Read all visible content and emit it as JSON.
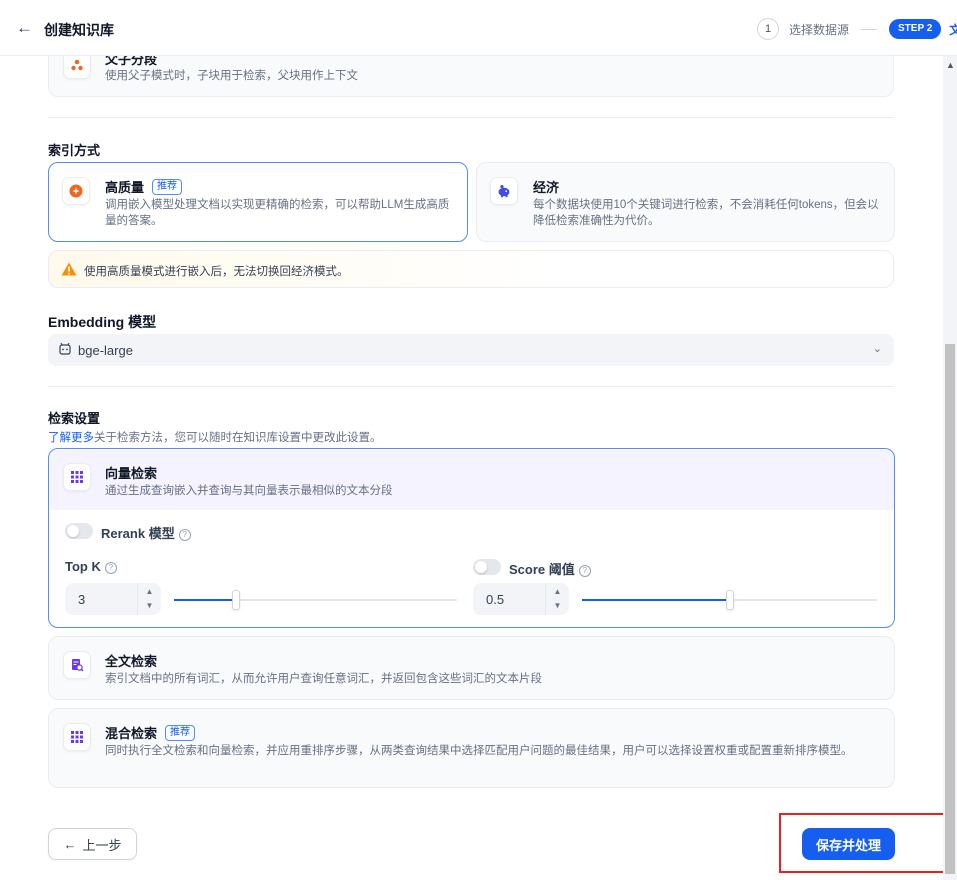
{
  "header": {
    "back_icon": "arrow-left-icon",
    "title": "创建知识库",
    "steps": [
      {
        "num": "1",
        "label": "选择数据源"
      },
      {
        "pill": "STEP 2",
        "label": "文"
      }
    ]
  },
  "parent_child": {
    "icon": "parent-child-icon",
    "title": "父子分段",
    "desc": "使用父子模式时，子块用于检索，父块用作上下文"
  },
  "index": {
    "title": "索引方式",
    "options": [
      {
        "icon": "high-quality-icon",
        "title": "高质量",
        "badge": "推荐",
        "desc": "调用嵌入模型处理文档以实现更精确的检索，可以帮助LLM生成高质量的答案。"
      },
      {
        "icon": "piggy-bank-icon",
        "title": "经济",
        "desc": "每个数据块使用10个关键词进行检索，不会消耗任何tokens，但会以降低检索准确性为代价。"
      }
    ],
    "warning": "使用高质量模式进行嵌入后，无法切换回经济模式。"
  },
  "embedding": {
    "title": "Embedding 模型",
    "value": "bge-large"
  },
  "retrieval": {
    "title": "检索设置",
    "learn_more": "了解更多",
    "learn_text": "关于检索方法，您可以随时在知识库设置中更改此设置。",
    "vector": {
      "title": "向量检索",
      "desc": "通过生成查询嵌入并查询与其向量表示最相似的文本分段",
      "rerank_label": "Rerank 模型",
      "topk_label": "Top K",
      "topk_value": "3",
      "topk_fraction": 0.22,
      "score_label": "Score 阈值",
      "score_value": "0.5",
      "score_fraction": 0.5
    },
    "fulltext": {
      "title": "全文检索",
      "desc": "索引文档中的所有词汇，从而允许用户查询任意词汇，并返回包含这些词汇的文本片段"
    },
    "hybrid": {
      "title": "混合检索",
      "badge": "推荐",
      "desc": "同时执行全文检索和向量检索，并应用重排序步骤，从两类查询结果中选择匹配用户问题的最佳结果，用户可以选择设置权重或配置重新排序模型。"
    }
  },
  "footer": {
    "prev_label": "上一步",
    "save_label": "保存并处理"
  },
  "colors": {
    "accent": "#155eef",
    "highlight": "#e42320",
    "warning": "#f79009"
  }
}
